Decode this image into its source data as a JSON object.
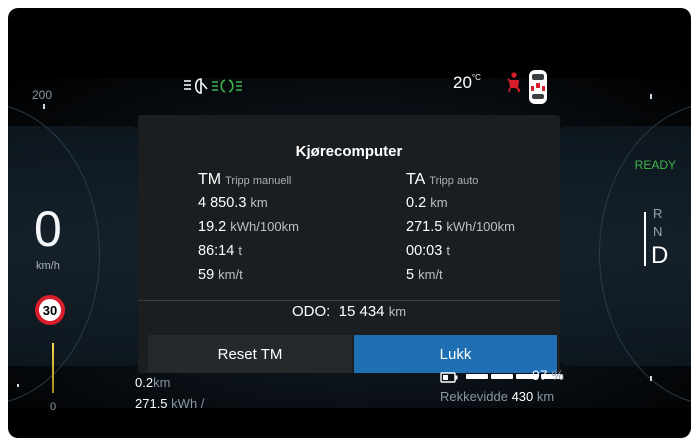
{
  "gauge": {
    "top_scale": "200",
    "bottom_scale": "0",
    "speed": "0",
    "speed_unit": "km/h",
    "speed_limit": "30"
  },
  "status": {
    "temperature_value": "20",
    "temperature_unit": "°C",
    "ready": "READY",
    "gears": {
      "r": "R",
      "n": "N",
      "d": "D"
    }
  },
  "popup": {
    "title": "Kjørecomputer",
    "tm": {
      "code": "TM",
      "name": "Tripp manuell",
      "distance": "4 850.3",
      "distance_unit": "km",
      "consumption": "19.2",
      "consumption_unit": "kWh/100km",
      "time": "86:14",
      "time_unit": "t",
      "speed": "59",
      "speed_unit": "km/t"
    },
    "ta": {
      "code": "TA",
      "name": "Tripp auto",
      "distance": "0.2",
      "distance_unit": "km",
      "consumption": "271.5",
      "consumption_unit": "kWh/100km",
      "time": "00:03",
      "time_unit": "t",
      "speed": "5",
      "speed_unit": "km/t"
    },
    "odo_label": "ODO:",
    "odo_value": "15 434",
    "odo_unit": "km",
    "reset_label": "Reset TM",
    "close_label": "Lukk"
  },
  "bottom_left": {
    "distance": "0.2",
    "distance_unit": "km",
    "consumption": "271.5",
    "consumption_unit": "kWh /"
  },
  "bottom_right": {
    "battery_percent": "97",
    "battery_unit": "%",
    "battery_level": 0.97,
    "range_label": "Rekkevidde",
    "range_value": "430",
    "range_unit": "km"
  },
  "colors": {
    "accent": "#1e6fb3",
    "ready": "#3db54a",
    "light_green": "#3db54a",
    "warning_red": "#d81e2a"
  },
  "icons": [
    "headlight-icon",
    "parking-light-icon",
    "seatbelt-warning-icon",
    "car-top-view-icon",
    "battery-icon"
  ]
}
